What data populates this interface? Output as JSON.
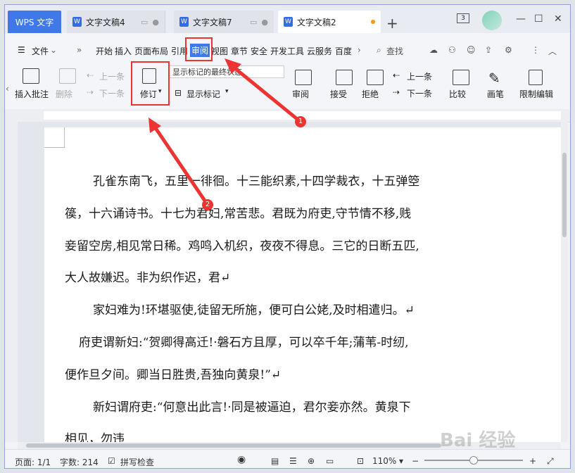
{
  "tabs": {
    "wps": "WPS 文字",
    "doc4": "文字文稿4",
    "doc7": "文字文稿7",
    "doc2": "文字文稿2",
    "add": "+"
  },
  "window": {
    "count": "3",
    "minimize": "—",
    "maximize": "☐",
    "close": "✕"
  },
  "menu": {
    "hamburger": "☰",
    "file": "文件",
    "items": [
      "开始",
      "插入",
      "页面布局",
      "引用",
      "审阅",
      "视图",
      "章节",
      "安全",
      "开发工具",
      "云服务",
      "百度"
    ],
    "search": "查找",
    "more_left": "»",
    "more_right": "›"
  },
  "toolbar": {
    "insert_comment": "插入批注",
    "delete": "删除",
    "prev_comment": "上一条",
    "next_comment": "下一条",
    "track_changes": "修订",
    "display_mode": "显示标记的最终状态",
    "show_markup": "显示标记",
    "review": "审阅",
    "accept": "接受",
    "reject": "拒绝",
    "prev_change": "上一条",
    "next_change": "下一条",
    "compare": "比较",
    "ink": "画笔",
    "restrict_edit": "限制编辑"
  },
  "document": {
    "lines": [
      "孔雀东南飞，五里一徘徊。十三能织素,十四学裁衣，十五弹箜",
      "篌，十六诵诗书。十七为君妇,常苦悲。君既为府吏,守节情不移,贱",
      "妾留空房,相见常日稀。鸡鸣入机织，夜夜不得息。三它的日断五匹,",
      "大人故嫌迟。非为织作迟，君↵",
      "家妇难为!环堪驱使,徒留无所施，便可白公姥,及时相遣归。↵",
      "府吏谓新妇:“贺卿得高迁!·磐石方且厚，可以卒千年;蒲苇-时纫,",
      "便作旦夕间。卿当日胜贵,吾独向黄泉!”↵",
      "新妇谓府吏:“何意出此言!·同是被逼迫，君尔妾亦然。黄泉下",
      "相见，勿违"
    ]
  },
  "status": {
    "page": "页面: 1/1",
    "words": "字数: 214",
    "spellcheck": "拼写检查",
    "zoom": "110%"
  },
  "annotations": {
    "badge1": "1",
    "badge2": "2"
  },
  "watermark": "Bai 经验",
  "colors": {
    "accent": "#3f79e9",
    "annotation": "#e33333"
  }
}
